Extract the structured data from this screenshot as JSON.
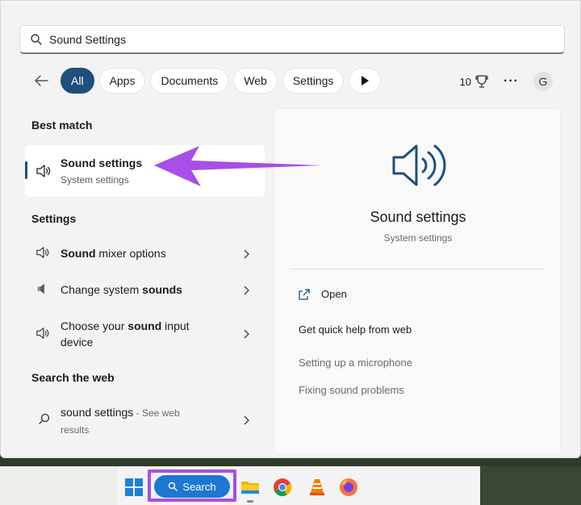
{
  "search": {
    "value": "Sound Settings"
  },
  "filters": {
    "chips": [
      "All",
      "Apps",
      "Documents",
      "Web",
      "Settings"
    ],
    "count": "10",
    "avatar": "G"
  },
  "best_match": {
    "heading": "Best match",
    "title": "Sound settings",
    "subtitle": "System settings"
  },
  "settings": {
    "heading": "Settings",
    "items": [
      {
        "bold": "Sound",
        "rest": " mixer options"
      },
      {
        "pre": "Change system ",
        "bold": "sounds"
      },
      {
        "pre": "Choose your ",
        "bold": "sound",
        "rest": " input",
        "line2": "device"
      }
    ]
  },
  "web": {
    "heading": "Search the web",
    "query": "sound settings",
    "suffix": " - See web",
    "line2": "results"
  },
  "preview": {
    "title": "Sound settings",
    "subtitle": "System settings",
    "open": "Open",
    "help_heading": "Get quick help from web",
    "links": [
      "Setting up a microphone",
      "Fixing sound problems"
    ]
  },
  "taskbar": {
    "search_label": "Search"
  },
  "colors": {
    "accent": "#1f4f7c",
    "arrow": "#a94ee6",
    "search_pill": "#1e77d2"
  }
}
